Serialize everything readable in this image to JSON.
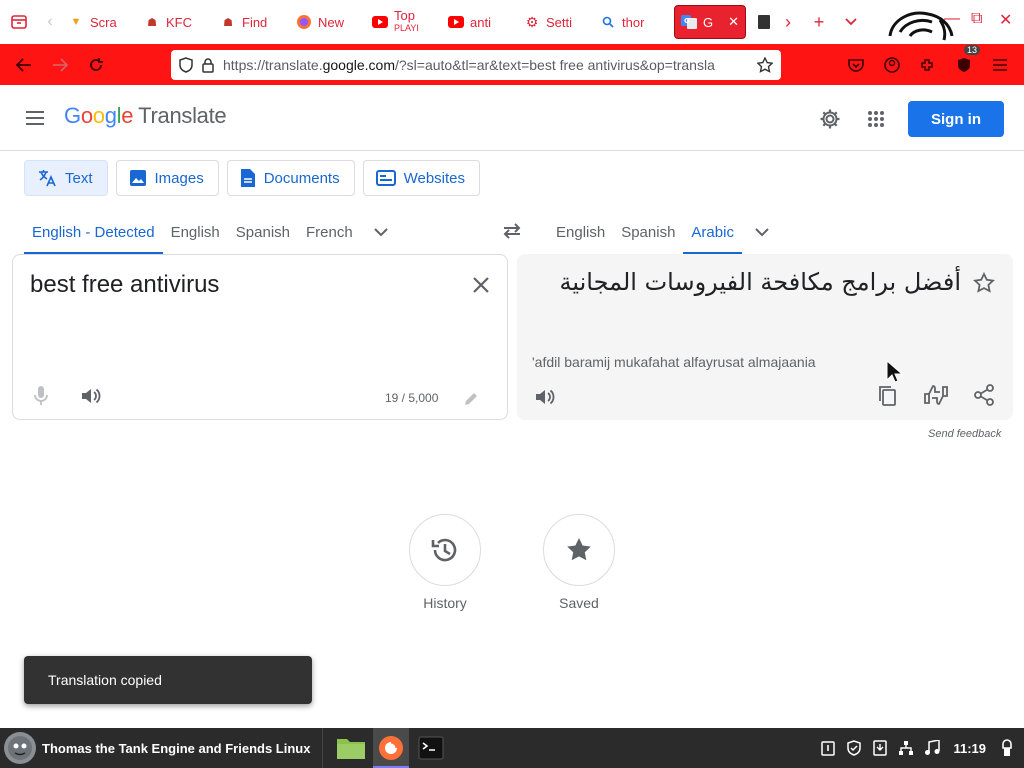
{
  "browser": {
    "tabs": [
      {
        "label": "Scra",
        "icon": "ice-cream-icon",
        "color": "#f0a020"
      },
      {
        "label": "KFC",
        "icon": "kfc-icon",
        "color": "#c0392b"
      },
      {
        "label": "Find",
        "icon": "kfc-icon",
        "color": "#c0392b"
      },
      {
        "label": "New",
        "icon": "firefox-icon",
        "color": "#ff7139"
      },
      {
        "label": "Top",
        "sublabel": "PLAYI",
        "icon": "youtube-icon",
        "color": "#ff0000"
      },
      {
        "label": "anti",
        "icon": "youtube-icon",
        "color": "#ff0000"
      },
      {
        "label": "Setti",
        "icon": "gear-icon",
        "color": "#e0243a"
      },
      {
        "label": "thor",
        "icon": "search-icon",
        "color": "#1a73e8"
      }
    ],
    "active_tab": {
      "label": "G",
      "icon": "google-translate-icon"
    },
    "url_prefix": "https://translate.",
    "url_domain": "google.com",
    "url_suffix": "/?sl=auto&tl=ar&text=best free antivirus&op=transla",
    "extension_badge": "13"
  },
  "header": {
    "logo_letters": [
      "G",
      "o",
      "o",
      "g",
      "l",
      "e"
    ],
    "logo_colors": [
      "#4285f4",
      "#ea4335",
      "#fbbc05",
      "#4285f4",
      "#34a853",
      "#ea4335"
    ],
    "product": "Translate",
    "signin_label": "Sign in"
  },
  "modes": [
    {
      "label": "Text",
      "icon": "translate-icon",
      "active": true
    },
    {
      "label": "Images",
      "icon": "image-icon",
      "active": false
    },
    {
      "label": "Documents",
      "icon": "document-icon",
      "active": false
    },
    {
      "label": "Websites",
      "icon": "website-icon",
      "active": false
    }
  ],
  "source_langs": [
    "English - Detected",
    "English",
    "Spanish",
    "French"
  ],
  "target_langs": [
    "English",
    "Spanish",
    "Arabic"
  ],
  "source": {
    "text": "best free antivirus",
    "char_count": "19 / 5,000"
  },
  "target": {
    "text": "أفضل برامج مكافحة الفيروسات المجانية",
    "transliteration": "'afdil baramij mukafahat alfayrusat almajaania",
    "feedback": "Send feedback"
  },
  "bottom": {
    "history_label": "History",
    "saved_label": "Saved"
  },
  "snackbar": "Translation copied",
  "taskbar": {
    "menu_label": "Thomas the Tank Engine and Friends Linux",
    "clock": "11:19"
  },
  "colors": {
    "accent": "#1a73e8",
    "browser_red": "#ff1414"
  }
}
